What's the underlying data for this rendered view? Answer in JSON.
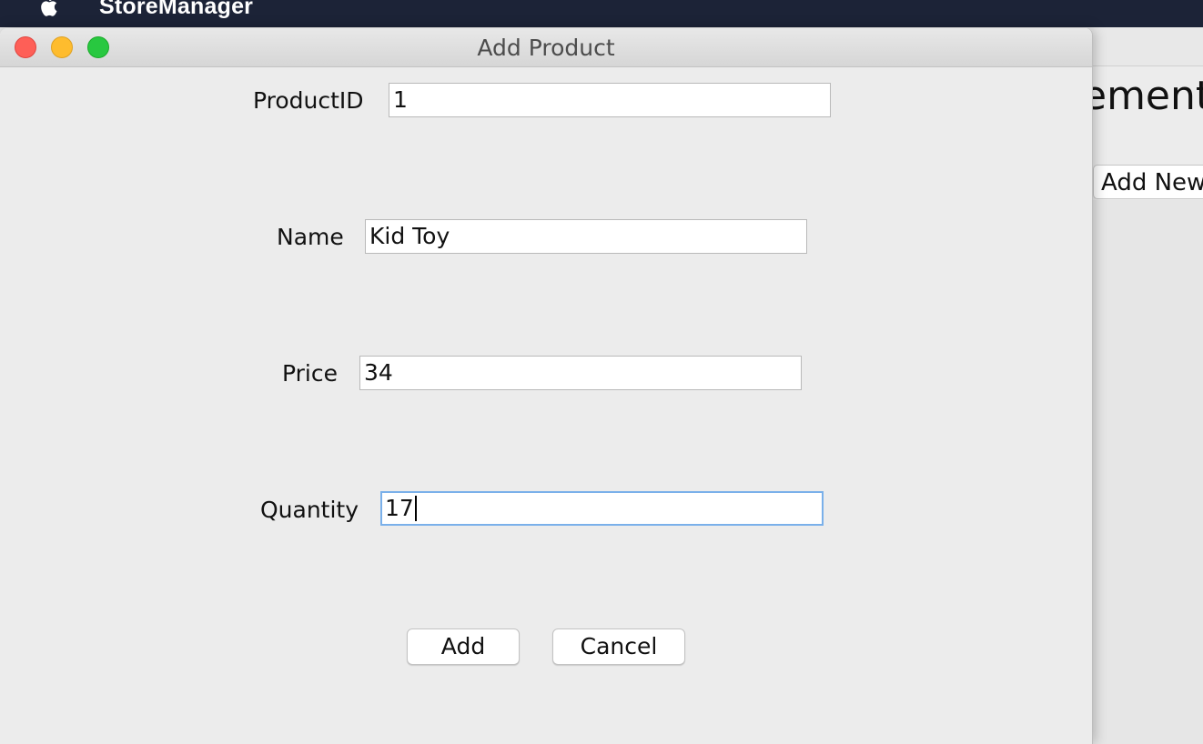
{
  "menubar": {
    "app_name": "StoreManager"
  },
  "background_window": {
    "heading": "ement",
    "add_new_label": "Add New"
  },
  "dialog": {
    "title": "Add Product",
    "fields": {
      "product_id": {
        "label": "ProductID",
        "value": "1"
      },
      "name": {
        "label": "Name",
        "value": "Kid Toy"
      },
      "price": {
        "label": "Price",
        "value": "34"
      },
      "quantity": {
        "label": "Quantity",
        "value": "17"
      }
    },
    "buttons": {
      "add": "Add",
      "cancel": "Cancel"
    }
  }
}
